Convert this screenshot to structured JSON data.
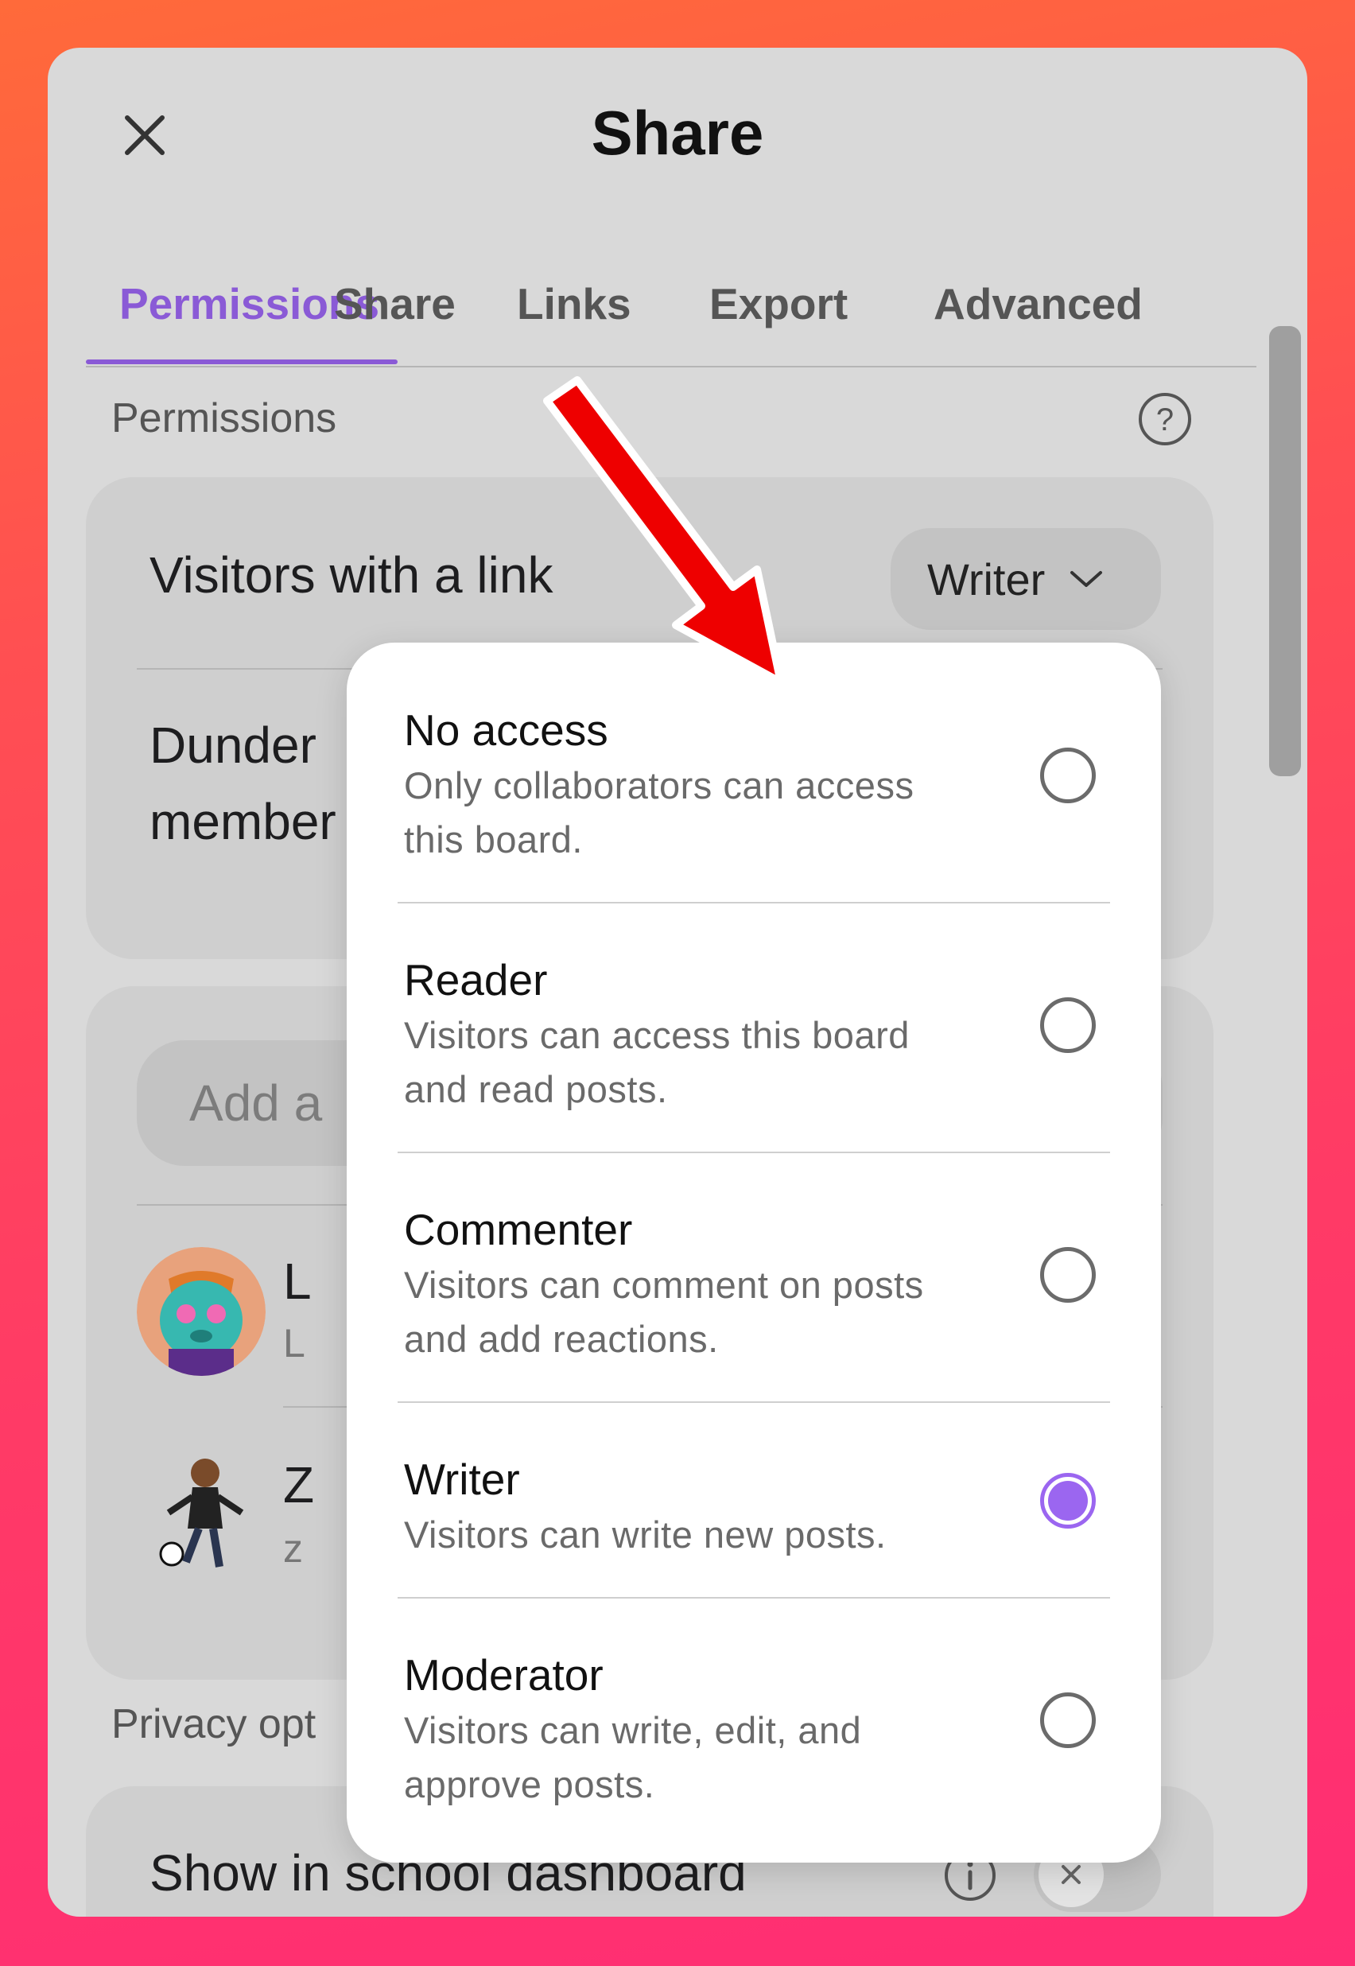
{
  "dialog": {
    "title": "Share",
    "close_label": "close-icon"
  },
  "tabs": [
    {
      "label": "Permissions",
      "active": true
    },
    {
      "label": "Share",
      "active": false
    },
    {
      "label": "Links",
      "active": false
    },
    {
      "label": "Export",
      "active": false
    },
    {
      "label": "Advanced",
      "active": false
    }
  ],
  "permissions": {
    "section_label": "Permissions",
    "visitors_label": "Visitors with a link",
    "visitors_value": "Writer",
    "org_label_line1": "Dunder",
    "org_label_line2": "member"
  },
  "collaborators": {
    "search_placeholder": "Add a",
    "people": [
      {
        "name": "L",
        "sub": "L"
      },
      {
        "name": "Z",
        "sub": "z"
      }
    ]
  },
  "privacy": {
    "section_label": "Privacy opt",
    "dashboard_label": "Show in school dashboard",
    "dashboard_enabled": false
  },
  "dropdown": {
    "options": [
      {
        "title": "No access",
        "desc": "Only collaborators can access this board.",
        "selected": false
      },
      {
        "title": "Reader",
        "desc": "Visitors can access this board and read posts.",
        "selected": false
      },
      {
        "title": "Commenter",
        "desc": "Visitors can comment on posts and add reactions.",
        "selected": false
      },
      {
        "title": "Writer",
        "desc": "Visitors can write new posts.",
        "selected": true
      },
      {
        "title": "Moderator",
        "desc": "Visitors can write, edit, and approve posts.",
        "selected": false
      }
    ]
  },
  "colors": {
    "accent": "#8a5ad6",
    "radio_selected": "#9b66f0",
    "annotation_arrow": "#ee0000"
  }
}
